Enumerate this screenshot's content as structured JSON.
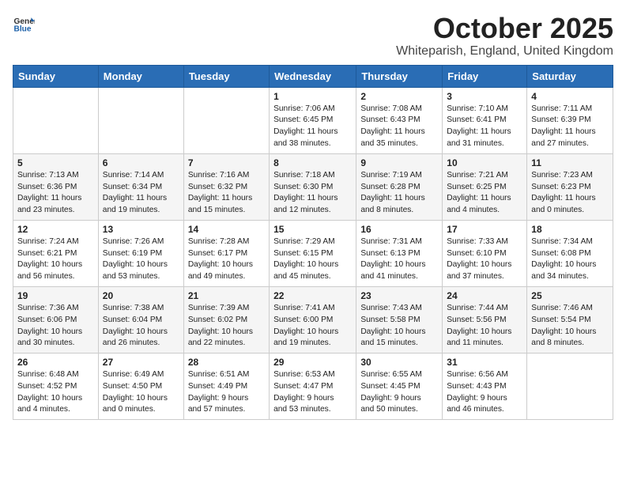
{
  "logo": {
    "text_general": "General",
    "text_blue": "Blue"
  },
  "title": {
    "month": "October 2025",
    "location": "Whiteparish, England, United Kingdom"
  },
  "headers": [
    "Sunday",
    "Monday",
    "Tuesday",
    "Wednesday",
    "Thursday",
    "Friday",
    "Saturday"
  ],
  "weeks": [
    [
      {
        "day": "",
        "info": ""
      },
      {
        "day": "",
        "info": ""
      },
      {
        "day": "",
        "info": ""
      },
      {
        "day": "1",
        "info": "Sunrise: 7:06 AM\nSunset: 6:45 PM\nDaylight: 11 hours\nand 38 minutes."
      },
      {
        "day": "2",
        "info": "Sunrise: 7:08 AM\nSunset: 6:43 PM\nDaylight: 11 hours\nand 35 minutes."
      },
      {
        "day": "3",
        "info": "Sunrise: 7:10 AM\nSunset: 6:41 PM\nDaylight: 11 hours\nand 31 minutes."
      },
      {
        "day": "4",
        "info": "Sunrise: 7:11 AM\nSunset: 6:39 PM\nDaylight: 11 hours\nand 27 minutes."
      }
    ],
    [
      {
        "day": "5",
        "info": "Sunrise: 7:13 AM\nSunset: 6:36 PM\nDaylight: 11 hours\nand 23 minutes."
      },
      {
        "day": "6",
        "info": "Sunrise: 7:14 AM\nSunset: 6:34 PM\nDaylight: 11 hours\nand 19 minutes."
      },
      {
        "day": "7",
        "info": "Sunrise: 7:16 AM\nSunset: 6:32 PM\nDaylight: 11 hours\nand 15 minutes."
      },
      {
        "day": "8",
        "info": "Sunrise: 7:18 AM\nSunset: 6:30 PM\nDaylight: 11 hours\nand 12 minutes."
      },
      {
        "day": "9",
        "info": "Sunrise: 7:19 AM\nSunset: 6:28 PM\nDaylight: 11 hours\nand 8 minutes."
      },
      {
        "day": "10",
        "info": "Sunrise: 7:21 AM\nSunset: 6:25 PM\nDaylight: 11 hours\nand 4 minutes."
      },
      {
        "day": "11",
        "info": "Sunrise: 7:23 AM\nSunset: 6:23 PM\nDaylight: 11 hours\nand 0 minutes."
      }
    ],
    [
      {
        "day": "12",
        "info": "Sunrise: 7:24 AM\nSunset: 6:21 PM\nDaylight: 10 hours\nand 56 minutes."
      },
      {
        "day": "13",
        "info": "Sunrise: 7:26 AM\nSunset: 6:19 PM\nDaylight: 10 hours\nand 53 minutes."
      },
      {
        "day": "14",
        "info": "Sunrise: 7:28 AM\nSunset: 6:17 PM\nDaylight: 10 hours\nand 49 minutes."
      },
      {
        "day": "15",
        "info": "Sunrise: 7:29 AM\nSunset: 6:15 PM\nDaylight: 10 hours\nand 45 minutes."
      },
      {
        "day": "16",
        "info": "Sunrise: 7:31 AM\nSunset: 6:13 PM\nDaylight: 10 hours\nand 41 minutes."
      },
      {
        "day": "17",
        "info": "Sunrise: 7:33 AM\nSunset: 6:10 PM\nDaylight: 10 hours\nand 37 minutes."
      },
      {
        "day": "18",
        "info": "Sunrise: 7:34 AM\nSunset: 6:08 PM\nDaylight: 10 hours\nand 34 minutes."
      }
    ],
    [
      {
        "day": "19",
        "info": "Sunrise: 7:36 AM\nSunset: 6:06 PM\nDaylight: 10 hours\nand 30 minutes."
      },
      {
        "day": "20",
        "info": "Sunrise: 7:38 AM\nSunset: 6:04 PM\nDaylight: 10 hours\nand 26 minutes."
      },
      {
        "day": "21",
        "info": "Sunrise: 7:39 AM\nSunset: 6:02 PM\nDaylight: 10 hours\nand 22 minutes."
      },
      {
        "day": "22",
        "info": "Sunrise: 7:41 AM\nSunset: 6:00 PM\nDaylight: 10 hours\nand 19 minutes."
      },
      {
        "day": "23",
        "info": "Sunrise: 7:43 AM\nSunset: 5:58 PM\nDaylight: 10 hours\nand 15 minutes."
      },
      {
        "day": "24",
        "info": "Sunrise: 7:44 AM\nSunset: 5:56 PM\nDaylight: 10 hours\nand 11 minutes."
      },
      {
        "day": "25",
        "info": "Sunrise: 7:46 AM\nSunset: 5:54 PM\nDaylight: 10 hours\nand 8 minutes."
      }
    ],
    [
      {
        "day": "26",
        "info": "Sunrise: 6:48 AM\nSunset: 4:52 PM\nDaylight: 10 hours\nand 4 minutes."
      },
      {
        "day": "27",
        "info": "Sunrise: 6:49 AM\nSunset: 4:50 PM\nDaylight: 10 hours\nand 0 minutes."
      },
      {
        "day": "28",
        "info": "Sunrise: 6:51 AM\nSunset: 4:49 PM\nDaylight: 9 hours\nand 57 minutes."
      },
      {
        "day": "29",
        "info": "Sunrise: 6:53 AM\nSunset: 4:47 PM\nDaylight: 9 hours\nand 53 minutes."
      },
      {
        "day": "30",
        "info": "Sunrise: 6:55 AM\nSunset: 4:45 PM\nDaylight: 9 hours\nand 50 minutes."
      },
      {
        "day": "31",
        "info": "Sunrise: 6:56 AM\nSunset: 4:43 PM\nDaylight: 9 hours\nand 46 minutes."
      },
      {
        "day": "",
        "info": ""
      }
    ]
  ]
}
